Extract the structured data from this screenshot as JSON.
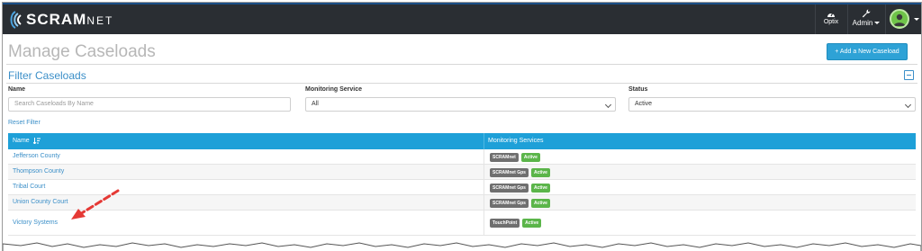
{
  "app": {
    "logo": {
      "brand": "SCRAM",
      "suffix": "NET"
    },
    "nav": {
      "optix_label": "Optix",
      "admin_label": "Admin"
    }
  },
  "page": {
    "title": "Manage Caseloads",
    "add_button": "+ Add a New Caseload"
  },
  "filter": {
    "title": "Filter Caseloads",
    "name_label": "Name",
    "name_placeholder": "Search Caseloads By Name",
    "service_label": "Monitoring Service",
    "service_value": "All",
    "status_label": "Status",
    "status_value": "Active",
    "reset_label": "Reset Filter"
  },
  "table": {
    "columns": {
      "name": "Name",
      "services": "Monitoring Services"
    },
    "rows": [
      {
        "name": "Jefferson County",
        "service": "SCRAMnet",
        "status": "Active"
      },
      {
        "name": "Thompson County",
        "service": "SCRAMnet Gps",
        "status": "Active"
      },
      {
        "name": "Tribal Court",
        "service": "SCRAMnet Gps",
        "status": "Active"
      },
      {
        "name": "Union County Court",
        "service": "SCRAMnet Gps",
        "status": "Active"
      },
      {
        "name": "Victory Systems",
        "service": "TouchPoint",
        "status": "Active"
      }
    ]
  },
  "colors": {
    "accent": "#1ea0d8",
    "link": "#3b8fc8",
    "active_badge": "#5bb54a",
    "service_badge": "#6f6f6f",
    "annotation_arrow": "#e53935",
    "topbar": "#2a2e33"
  },
  "icons": {
    "logo": "wave-logo-icon",
    "optix": "dashboard-gauge-icon",
    "admin": "wrench-icon",
    "user": "user-avatar-icon",
    "collapse": "minus-square-icon",
    "sort": "sort-ascending-icon",
    "annotation": "red-dashed-arrow-icon"
  }
}
